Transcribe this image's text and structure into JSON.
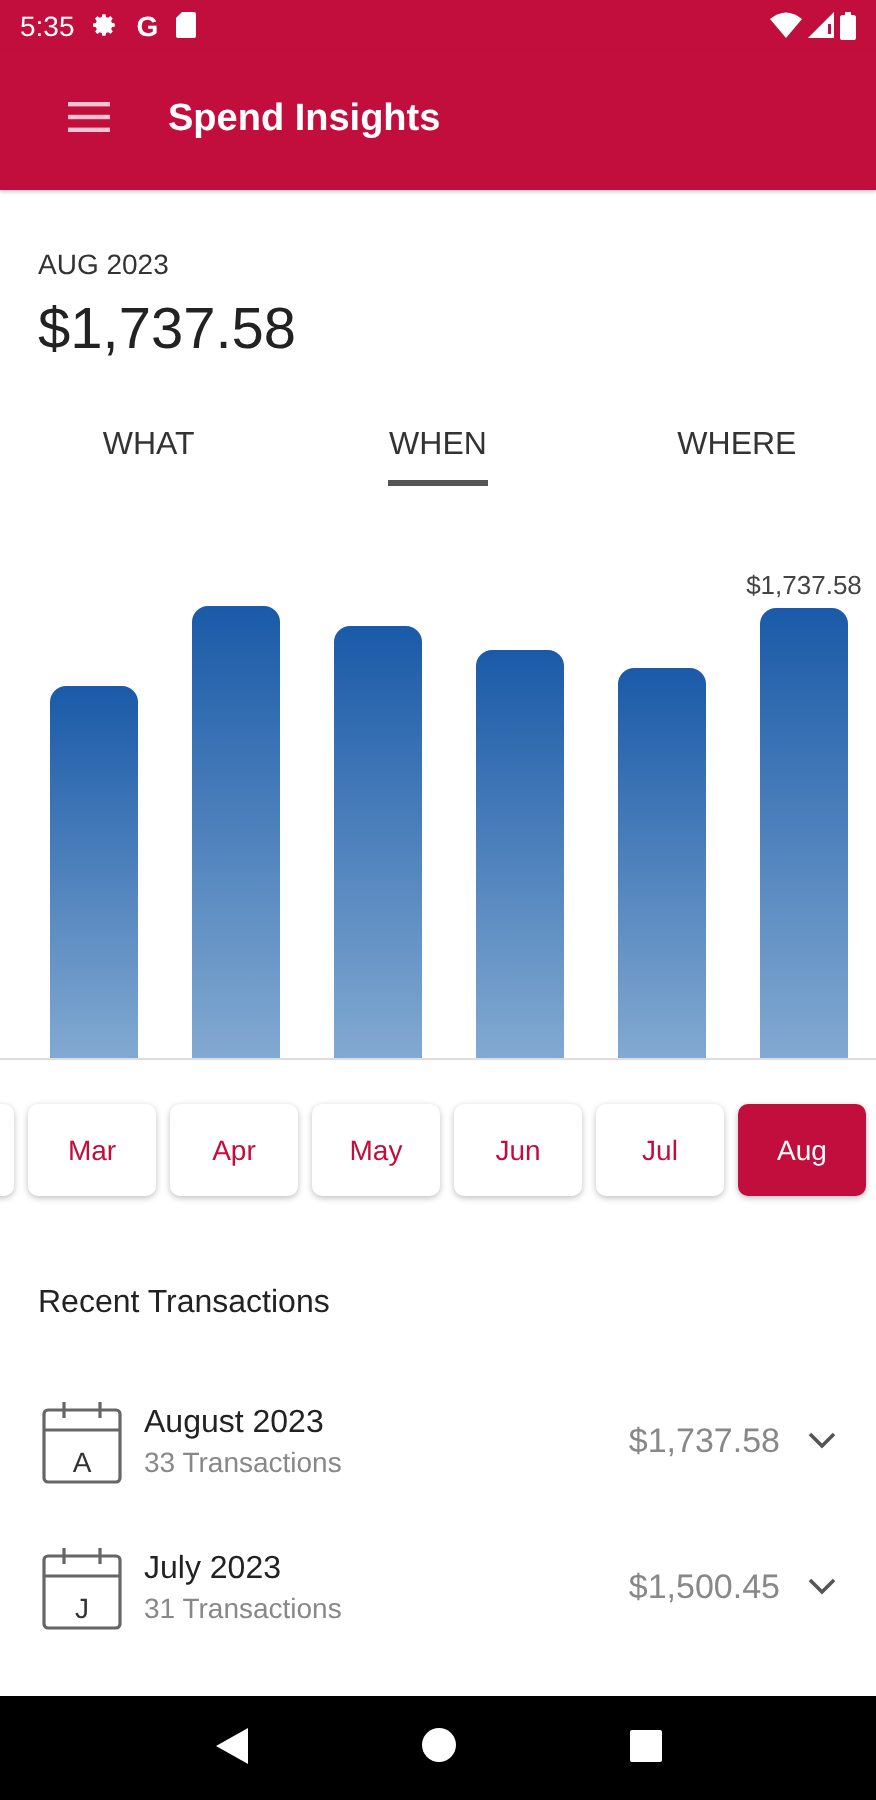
{
  "status_bar": {
    "time": "5:35",
    "g_label": "G"
  },
  "app_bar": {
    "title": "Spend Insights"
  },
  "summary": {
    "period": "AUG 2023",
    "amount": "$1,737.58"
  },
  "tabs": [
    {
      "label": "WHAT",
      "selected": false
    },
    {
      "label": "WHEN",
      "selected": true
    },
    {
      "label": "WHERE",
      "selected": false
    }
  ],
  "chart": {
    "value_label": "$1,737.58"
  },
  "months": [
    {
      "label": "Mar",
      "selected": false
    },
    {
      "label": "Apr",
      "selected": false
    },
    {
      "label": "May",
      "selected": false
    },
    {
      "label": "Jun",
      "selected": false
    },
    {
      "label": "Jul",
      "selected": false
    },
    {
      "label": "Aug",
      "selected": true
    }
  ],
  "recent": {
    "title": "Recent Transactions",
    "items": [
      {
        "icon_letter": "A",
        "title": "August 2023",
        "subtitle": "33 Transactions",
        "amount": "$1,737.58"
      },
      {
        "icon_letter": "J",
        "title": "July 2023",
        "subtitle": "31 Transactions",
        "amount": "$1,500.45"
      }
    ]
  }
}
